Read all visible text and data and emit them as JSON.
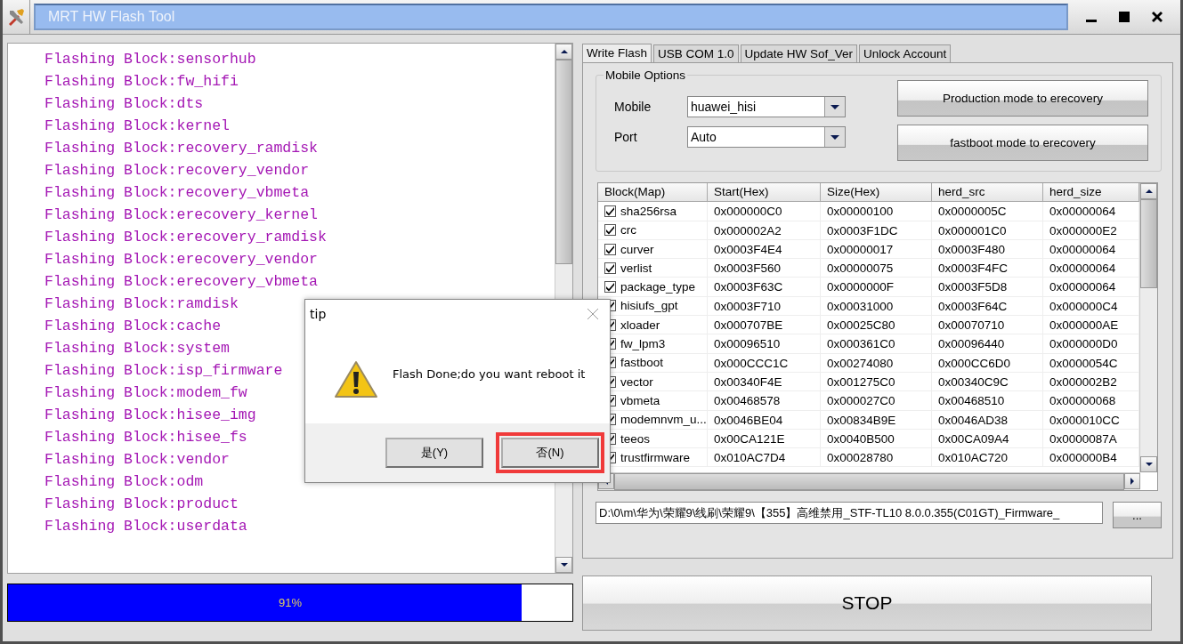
{
  "window": {
    "title": "MRT HW Flash Tool"
  },
  "log": {
    "lines": [
      "Flashing Block:sensorhub",
      "Flashing Block:fw_hifi",
      "Flashing Block:dts",
      "Flashing Block:kernel",
      "Flashing Block:recovery_ramdisk",
      "Flashing Block:recovery_vendor",
      "Flashing Block:recovery_vbmeta",
      "Flashing Block:erecovery_kernel",
      "Flashing Block:erecovery_ramdisk",
      "Flashing Block:erecovery_vendor",
      "Flashing Block:erecovery_vbmeta",
      "Flashing Block:ramdisk",
      "Flashing Block:cache",
      "Flashing Block:system",
      "Flashing Block:isp_firmware",
      "Flashing Block:modem_fw",
      "Flashing Block:hisee_img",
      "Flashing Block:hisee_fs",
      "Flashing Block:vendor",
      "Flashing Block:odm",
      "Flashing Block:product",
      "Flashing Block:userdata"
    ]
  },
  "progress": {
    "level": 0.91,
    "label": "91%"
  },
  "tabs": [
    {
      "label": "Write Flash",
      "selected": true
    },
    {
      "label": "USB COM 1.0",
      "selected": false
    },
    {
      "label": "Update HW Sof_Ver",
      "selected": false
    },
    {
      "label": "Unlock Account",
      "selected": false
    }
  ],
  "mobile_options": {
    "title": "Mobile Options",
    "fields": [
      {
        "label": "Mobile",
        "value": "huawei_hisi"
      },
      {
        "label": "Port",
        "value": "Auto"
      }
    ],
    "buttons": [
      "Production mode to erecovery",
      "fastboot mode to erecovery"
    ]
  },
  "table": {
    "columns": [
      "Block(Map)",
      "Start(Hex)",
      "Size(Hex)",
      "herd_src",
      "herd_size"
    ],
    "rows": [
      {
        "checked": true,
        "cells": [
          "sha256rsa",
          "0x000000C0",
          "0x00000100",
          "0x0000005C",
          "0x00000064"
        ]
      },
      {
        "checked": true,
        "cells": [
          "crc",
          "0x000002A2",
          "0x0003F1DC",
          "0x000001C0",
          "0x000000E2"
        ]
      },
      {
        "checked": true,
        "cells": [
          "curver",
          "0x0003F4E4",
          "0x00000017",
          "0x0003F480",
          "0x00000064"
        ]
      },
      {
        "checked": true,
        "cells": [
          "verlist",
          "0x0003F560",
          "0x00000075",
          "0x0003F4FC",
          "0x00000064"
        ]
      },
      {
        "checked": true,
        "cells": [
          "package_type",
          "0x0003F63C",
          "0x0000000F",
          "0x0003F5D8",
          "0x00000064"
        ]
      },
      {
        "checked": true,
        "cells": [
          "hisiufs_gpt",
          "0x0003F710",
          "0x00031000",
          "0x0003F64C",
          "0x000000C4"
        ]
      },
      {
        "checked": true,
        "cells": [
          "xloader",
          "0x000707BE",
          "0x00025C80",
          "0x00070710",
          "0x000000AE"
        ]
      },
      {
        "checked": true,
        "cells": [
          "fw_lpm3",
          "0x00096510",
          "0x000361C0",
          "0x00096440",
          "0x000000D0"
        ]
      },
      {
        "checked": true,
        "cells": [
          "fastboot",
          "0x000CCC1C",
          "0x00274080",
          "0x000CC6D0",
          "0x0000054C"
        ]
      },
      {
        "checked": true,
        "cells": [
          "vector",
          "0x00340F4E",
          "0x001275C0",
          "0x00340C9C",
          "0x000002B2"
        ]
      },
      {
        "checked": true,
        "cells": [
          "vbmeta",
          "0x00468578",
          "0x000027C0",
          "0x00468510",
          "0x00000068"
        ]
      },
      {
        "checked": true,
        "cells": [
          "modemnvm_u...",
          "0x0046BE04",
          "0x00834B9E",
          "0x0046AD38",
          "0x000010CC"
        ]
      },
      {
        "checked": true,
        "cells": [
          "teeos",
          "0x00CA121E",
          "0x0040B500",
          "0x00CA09A4",
          "0x0000087A"
        ]
      },
      {
        "checked": true,
        "cells": [
          "trustfirmware",
          "0x010AC7D4",
          "0x00028780",
          "0x010AC720",
          "0x000000B4"
        ]
      }
    ]
  },
  "firmware_path": {
    "value": "D:\\0\\m\\华为\\荣耀9\\线刷\\荣耀9\\【355】高维禁用_STF-TL10 8.0.0.355(C01GT)_Firmware_"
  },
  "browse_button": "...",
  "stop_button": "STOP",
  "dialog": {
    "title": "tip",
    "message": "Flash Done;do you want reboot it",
    "buttons": [
      {
        "label": "是(Y)",
        "highlighted": false
      },
      {
        "label": "否(N)",
        "highlighted": true
      }
    ]
  }
}
